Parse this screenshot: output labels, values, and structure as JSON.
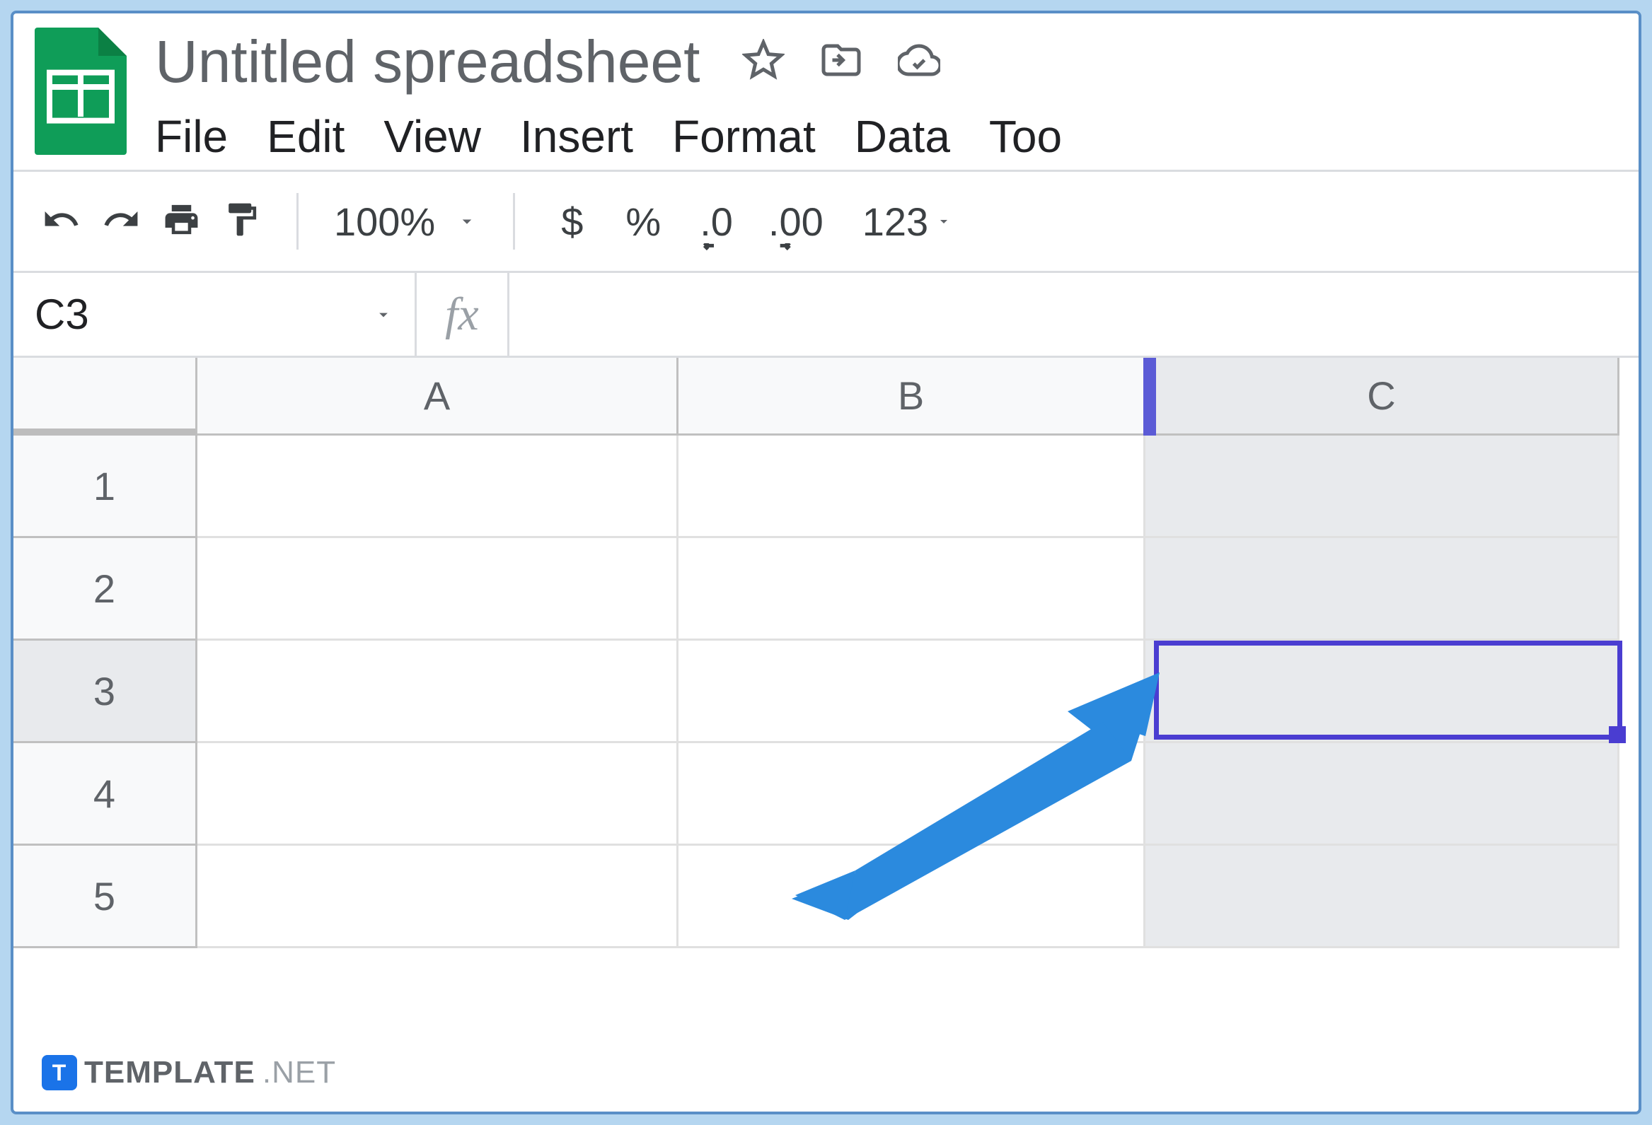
{
  "header": {
    "title": "Untitled spreadsheet"
  },
  "menus": {
    "file": "File",
    "edit": "Edit",
    "view": "View",
    "insert": "Insert",
    "format": "Format",
    "data": "Data",
    "tools": "Too"
  },
  "toolbar": {
    "zoom": "100%",
    "currency": "$",
    "percent": "%",
    "dec_decrease": ".0",
    "dec_increase": ".00",
    "format_more": "123"
  },
  "namebox": {
    "value": "C3",
    "fx": "fx"
  },
  "columns": [
    "A",
    "B",
    "C"
  ],
  "rows": [
    "1",
    "2",
    "3",
    "4",
    "5"
  ],
  "selected": {
    "col": "C",
    "row": "3"
  },
  "watermark": {
    "brand": "TEMPLATE",
    "suffix": ".NET",
    "icon": "T"
  }
}
